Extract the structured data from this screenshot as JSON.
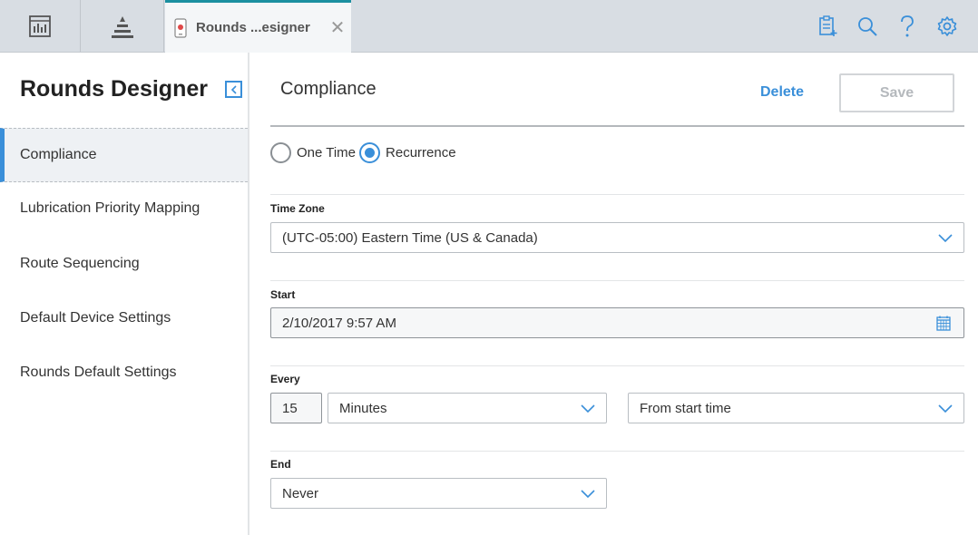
{
  "tab": {
    "label": "Rounds ...esigner"
  },
  "toolbar": {
    "dashboard_icon": "dashboard-icon",
    "hierarchy_icon": "hierarchy-icon",
    "tools": [
      "add-note-icon",
      "search-icon",
      "help-icon",
      "settings-icon"
    ]
  },
  "sidebar": {
    "title": "Rounds Designer",
    "items": [
      {
        "label": "Compliance",
        "active": true
      },
      {
        "label": "Lubrication Priority Mapping"
      },
      {
        "label": "Route Sequencing"
      },
      {
        "label": "Default Device Settings"
      },
      {
        "label": "Rounds Default Settings"
      }
    ]
  },
  "main": {
    "title": "Compliance",
    "delete_label": "Delete",
    "save_label": "Save",
    "schedule_type": {
      "one_time_label": "One Time",
      "recurrence_label": "Recurrence",
      "selected": "Recurrence"
    },
    "time_zone": {
      "label": "Time Zone",
      "value": "(UTC-05:00) Eastern Time (US & Canada)"
    },
    "start": {
      "label": "Start",
      "value": "2/10/2017 9:57 AM"
    },
    "every": {
      "label": "Every",
      "count": "15",
      "unit": "Minutes",
      "from": "From start time"
    },
    "end": {
      "label": "End",
      "value": "Never"
    }
  },
  "colors": {
    "accent": "#3a8fd9",
    "tab_accent": "#1b8fa0",
    "topbar": "#d8dde3"
  }
}
